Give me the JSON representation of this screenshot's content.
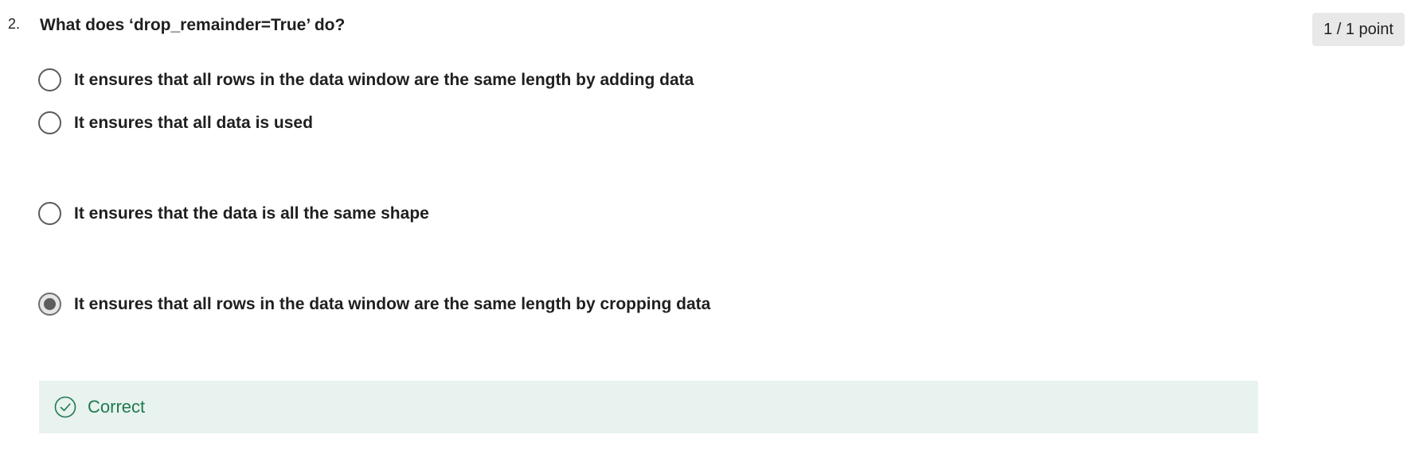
{
  "question": {
    "number": "2.",
    "title": "What does ‘drop_remainder=True’ do?",
    "points": "1 / 1 point"
  },
  "options": [
    {
      "label": "It ensures that all rows in the data window are the same length by adding data",
      "selected": false
    },
    {
      "label": "It ensures that all data is used",
      "selected": false
    },
    {
      "label": "It ensures that the data is all the same shape",
      "selected": false
    },
    {
      "label": "It ensures that all rows in the data window are the same length by cropping data",
      "selected": true
    }
  ],
  "feedback": {
    "status": "Correct",
    "icon": "check-circle-icon",
    "color": "#1e7a4f",
    "background": "#e8f2ee"
  }
}
